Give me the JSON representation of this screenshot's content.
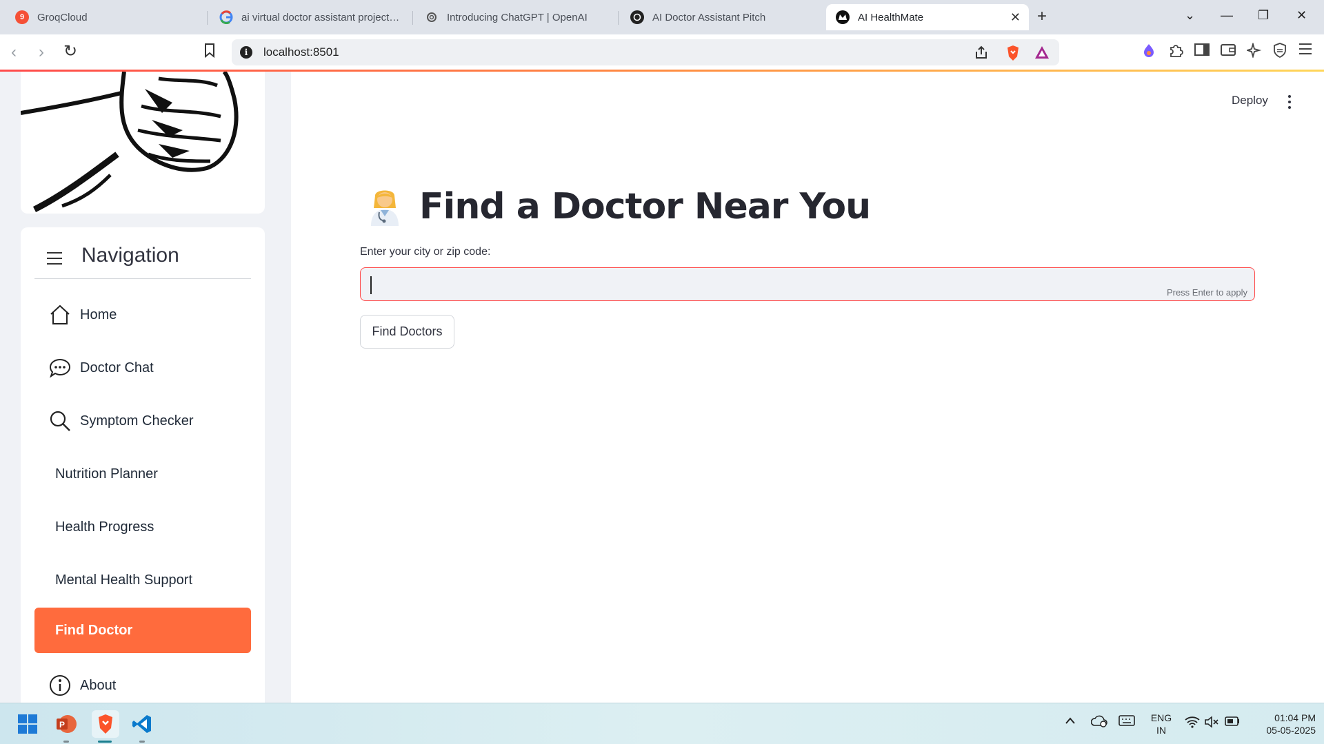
{
  "browser": {
    "tabs": [
      {
        "label": "GroqCloud",
        "badge": "9",
        "favicon_color": "#f55036"
      },
      {
        "label": "ai virtual doctor assistant project pp",
        "favicon_color": "#4285f4"
      },
      {
        "label": "Introducing ChatGPT | OpenAI",
        "favicon_color": "#555555"
      },
      {
        "label": "AI Doctor Assistant Pitch",
        "favicon_color": "#222222"
      },
      {
        "label": "AI HealthMate",
        "favicon_color": "#111111",
        "active": true
      }
    ],
    "new_tab": "+",
    "close_tab": "✕",
    "url": "localhost:8501",
    "info_badge": "i"
  },
  "header": {
    "deploy_label": "Deploy"
  },
  "sidebar": {
    "nav_title": "Navigation",
    "items": [
      {
        "label": "Home",
        "icon": "home-icon"
      },
      {
        "label": "Doctor Chat",
        "icon": "chat-icon"
      },
      {
        "label": "Symptom Checker",
        "icon": "search-icon"
      },
      {
        "label": "Nutrition Planner"
      },
      {
        "label": "Health Progress"
      },
      {
        "label": "Mental Health Support"
      },
      {
        "label": "Find Doctor",
        "active": true
      },
      {
        "label": "About",
        "icon": "info-icon"
      }
    ],
    "active_color": "#ff6b3d"
  },
  "main": {
    "title": "Find a Doctor Near You",
    "title_icon": "doctor-emoji-icon",
    "input_label": "Enter your city or zip code:",
    "input_value": "",
    "input_hint": "Press Enter to apply",
    "button_label": "Find Doctors",
    "accent": "#ff4b4b"
  },
  "taskbar": {
    "apps": [
      "windows-start-icon",
      "powerpoint-icon",
      "brave-icon",
      "vscode-icon"
    ],
    "lang_line1": "ENG",
    "lang_line2": "IN",
    "time": "01:04 PM",
    "date": "05-05-2025"
  }
}
